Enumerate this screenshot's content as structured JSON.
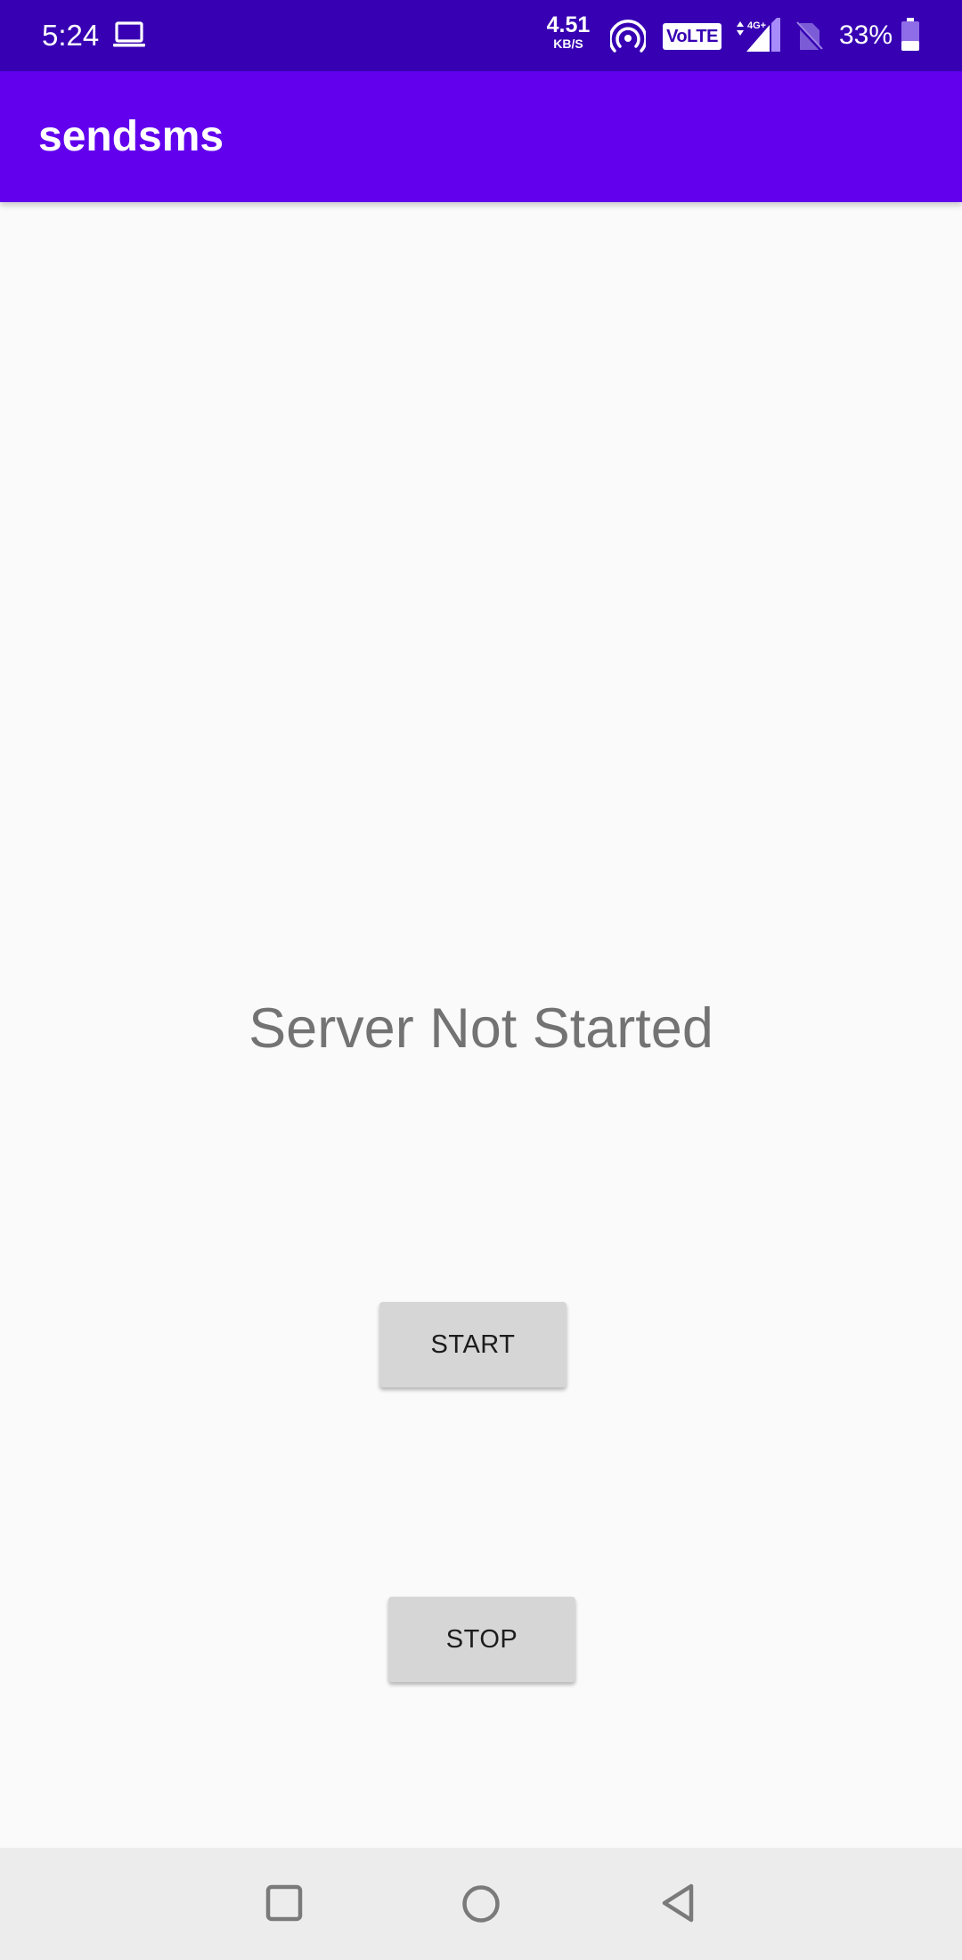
{
  "status_bar": {
    "time": "5:24",
    "net_speed_value": "4.51",
    "net_speed_unit": "KB/S",
    "volte_label": "VoLTE",
    "network_type": "4G+",
    "battery_percent": "33%",
    "battery_level": 0.33,
    "icons": [
      "laptop-icon",
      "hotspot-icon",
      "volte-icon",
      "signal-icon",
      "no-sim-icon",
      "battery-icon"
    ]
  },
  "app_bar": {
    "title": "sendsms"
  },
  "main": {
    "status_text": "Server Not Started",
    "start_label": "START",
    "stop_label": "STOP"
  },
  "nav_bar": {
    "icons": [
      "recents-icon",
      "home-icon",
      "back-icon"
    ]
  },
  "colors": {
    "status_bar": "#3700b3",
    "app_bar": "#6200ee",
    "background": "#fafafa",
    "button": "#d6d6d6",
    "status_text": "#737373",
    "nav_bar": "#ececec"
  }
}
